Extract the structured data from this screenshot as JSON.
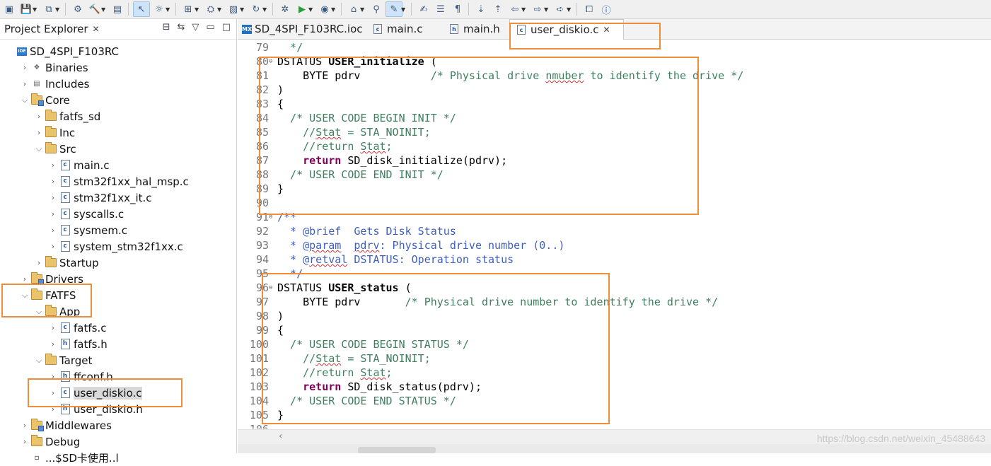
{
  "toolbar": {
    "icons": [
      "new-file-icon",
      "save-icon",
      "save-all-icon",
      "settings-icon",
      "build-hammer-icon",
      "binary-icon",
      "cursor-icon",
      "debug-icon",
      "new-project-icon",
      "publish-icon",
      "new-class-icon",
      "refresh-icon",
      "debug-bug-icon",
      "run-icon",
      "run-config-icon",
      "open-type-icon",
      "search-icon",
      "highlight-icon",
      "edit-icon",
      "list-icon",
      "pilcrow-icon",
      "next-annotation-icon",
      "prev-annotation-icon",
      "back-icon",
      "forward-icon",
      "forward-arrow-icon",
      "maximize-icon",
      "info-icon"
    ]
  },
  "explorer": {
    "title": "Project Explorer",
    "tree": [
      {
        "label": "SD_4SPI_F103RC",
        "type": "project",
        "level": 0,
        "expand": ""
      },
      {
        "label": "Binaries",
        "type": "binaries",
        "level": 1,
        "expand": "collapsed"
      },
      {
        "label": "Includes",
        "type": "includes",
        "level": 1,
        "expand": "collapsed"
      },
      {
        "label": "Core",
        "type": "src-folder",
        "level": 1,
        "expand": "expanded"
      },
      {
        "label": "fatfs_sd",
        "type": "folder",
        "level": 2,
        "expand": "collapsed"
      },
      {
        "label": "Inc",
        "type": "folder",
        "level": 2,
        "expand": "collapsed"
      },
      {
        "label": "Src",
        "type": "folder",
        "level": 2,
        "expand": "expanded"
      },
      {
        "label": "main.c",
        "type": "c",
        "level": 3,
        "expand": "collapsed"
      },
      {
        "label": "stm32f1xx_hal_msp.c",
        "type": "c",
        "level": 3,
        "expand": "collapsed"
      },
      {
        "label": "stm32f1xx_it.c",
        "type": "c",
        "level": 3,
        "expand": "collapsed"
      },
      {
        "label": "syscalls.c",
        "type": "c",
        "level": 3,
        "expand": "collapsed"
      },
      {
        "label": "sysmem.c",
        "type": "c",
        "level": 3,
        "expand": "collapsed"
      },
      {
        "label": "system_stm32f1xx.c",
        "type": "c",
        "level": 3,
        "expand": "collapsed"
      },
      {
        "label": "Startup",
        "type": "folder",
        "level": 2,
        "expand": "collapsed"
      },
      {
        "label": "Drivers",
        "type": "src-folder",
        "level": 1,
        "expand": "collapsed"
      },
      {
        "label": "FATFS",
        "type": "folder",
        "level": 1,
        "expand": "expanded"
      },
      {
        "label": "App",
        "type": "folder",
        "level": 2,
        "expand": "expanded"
      },
      {
        "label": "fatfs.c",
        "type": "c",
        "level": 3,
        "expand": "collapsed"
      },
      {
        "label": "fatfs.h",
        "type": "h",
        "level": 3,
        "expand": "collapsed"
      },
      {
        "label": "Target",
        "type": "folder",
        "level": 2,
        "expand": "expanded"
      },
      {
        "label": "ffconf.h",
        "type": "h",
        "level": 3,
        "expand": "collapsed"
      },
      {
        "label": "user_diskio.c",
        "type": "c",
        "level": 3,
        "expand": "collapsed",
        "selected": true
      },
      {
        "label": "user_diskio.h",
        "type": "h",
        "level": 3,
        "expand": "collapsed"
      },
      {
        "label": "Middlewares",
        "type": "src-folder",
        "level": 1,
        "expand": "collapsed"
      },
      {
        "label": "Debug",
        "type": "folder",
        "level": 1,
        "expand": "collapsed"
      },
      {
        "label": "...$SD卡使用..l",
        "type": "file",
        "level": 1,
        "expand": ""
      }
    ]
  },
  "editor": {
    "tabs": [
      {
        "label": "SD_4SPI_F103RC.ioc",
        "icon": "MX"
      },
      {
        "label": "main.c",
        "icon": "c"
      },
      {
        "label": "main.h",
        "icon": "h"
      },
      {
        "label": "user_diskio.c",
        "icon": "c",
        "active": true
      }
    ],
    "lines": [
      {
        "n": "79",
        "fold": "",
        "tokens": [
          [
            "cm",
            "  */"
          ]
        ]
      },
      {
        "n": "80",
        "fold": "⊖",
        "tokens": [
          [
            "",
            "DSTATUS "
          ],
          [
            "fn",
            "USER_initialize"
          ],
          [
            "",
            " ("
          ]
        ]
      },
      {
        "n": "81",
        "fold": "",
        "tokens": [
          [
            "",
            "    BYTE pdrv           "
          ],
          [
            "cm",
            "/* Physical drive "
          ],
          [
            "cmw",
            "nmuber"
          ],
          [
            "cm",
            " to identify the drive */"
          ]
        ]
      },
      {
        "n": "82",
        "fold": "",
        "tokens": [
          [
            "",
            ")"
          ]
        ]
      },
      {
        "n": "83",
        "fold": "",
        "tokens": [
          [
            "",
            "{"
          ]
        ]
      },
      {
        "n": "84",
        "fold": "",
        "tokens": [
          [
            "cm",
            "  /* USER CODE BEGIN INIT */"
          ]
        ]
      },
      {
        "n": "85",
        "fold": "",
        "tokens": [
          [
            "cm",
            "    //"
          ],
          [
            "cmw",
            "Stat"
          ],
          [
            "cm",
            " = STA_NOINIT;"
          ]
        ]
      },
      {
        "n": "86",
        "fold": "",
        "tokens": [
          [
            "cm",
            "    //return "
          ],
          [
            "cmw",
            "Stat"
          ],
          [
            "cm",
            ";"
          ]
        ]
      },
      {
        "n": "87",
        "fold": "",
        "tokens": [
          [
            "",
            "    "
          ],
          [
            "kw",
            "return"
          ],
          [
            "",
            " SD_disk_initialize(pdrv);"
          ]
        ]
      },
      {
        "n": "88",
        "fold": "",
        "tokens": [
          [
            "cm",
            "  /* USER CODE END INIT */"
          ]
        ]
      },
      {
        "n": "89",
        "fold": "",
        "tokens": [
          [
            "",
            "}"
          ]
        ]
      },
      {
        "n": "90",
        "fold": "",
        "tokens": []
      },
      {
        "n": "91",
        "fold": "⊖",
        "tokens": [
          [
            "dc",
            "/**"
          ]
        ]
      },
      {
        "n": "92",
        "fold": "",
        "tokens": [
          [
            "dc",
            "  * @brief  Gets Disk Status"
          ]
        ]
      },
      {
        "n": "93",
        "fold": "",
        "tokens": [
          [
            "dc",
            "  * @"
          ],
          [
            "dcw",
            "param"
          ],
          [
            "dc",
            "  "
          ],
          [
            "dcw",
            "pdrv"
          ],
          [
            "dc",
            ": Physical drive number (0..)"
          ]
        ]
      },
      {
        "n": "94",
        "fold": "",
        "tokens": [
          [
            "dc",
            "  * @"
          ],
          [
            "dcw",
            "retval"
          ],
          [
            "dc",
            " DSTATUS: Operation status"
          ]
        ]
      },
      {
        "n": "95",
        "fold": "",
        "tokens": [
          [
            "dc",
            "  */"
          ]
        ]
      },
      {
        "n": "96",
        "fold": "⊖",
        "tokens": [
          [
            "",
            "DSTATUS "
          ],
          [
            "fn",
            "USER_status"
          ],
          [
            "",
            " ("
          ]
        ]
      },
      {
        "n": "97",
        "fold": "",
        "tokens": [
          [
            "",
            "    BYTE pdrv       "
          ],
          [
            "cm",
            "/* Physical drive number to identify the drive */"
          ]
        ]
      },
      {
        "n": "98",
        "fold": "",
        "tokens": [
          [
            "",
            ")"
          ]
        ]
      },
      {
        "n": "99",
        "fold": "",
        "tokens": [
          [
            "",
            "{"
          ]
        ]
      },
      {
        "n": "100",
        "fold": "",
        "tokens": [
          [
            "cm",
            "  /* USER CODE BEGIN STATUS */"
          ]
        ]
      },
      {
        "n": "101",
        "fold": "",
        "tokens": [
          [
            "cm",
            "    //"
          ],
          [
            "cmw",
            "Stat"
          ],
          [
            "cm",
            " = STA_NOINIT;"
          ]
        ]
      },
      {
        "n": "102",
        "fold": "",
        "tokens": [
          [
            "cm",
            "    //return "
          ],
          [
            "cmw",
            "Stat"
          ],
          [
            "cm",
            ";"
          ]
        ]
      },
      {
        "n": "103",
        "fold": "",
        "tokens": [
          [
            "",
            "    "
          ],
          [
            "kw",
            "return"
          ],
          [
            "",
            " SD_disk_status(pdrv);"
          ]
        ]
      },
      {
        "n": "104",
        "fold": "",
        "tokens": [
          [
            "cm",
            "  /* USER CODE END STATUS */"
          ]
        ]
      },
      {
        "n": "105",
        "fold": "",
        "tokens": [
          [
            "",
            "}"
          ]
        ]
      },
      {
        "n": "106",
        "fold": "",
        "tokens": []
      }
    ]
  },
  "watermark": "https://blog.csdn.net/weixin_45488643",
  "colors": {
    "highlight": "#f08d3a",
    "keyword": "#7f0055",
    "comment": "#3f7f5f",
    "doc": "#3f5fbf"
  }
}
